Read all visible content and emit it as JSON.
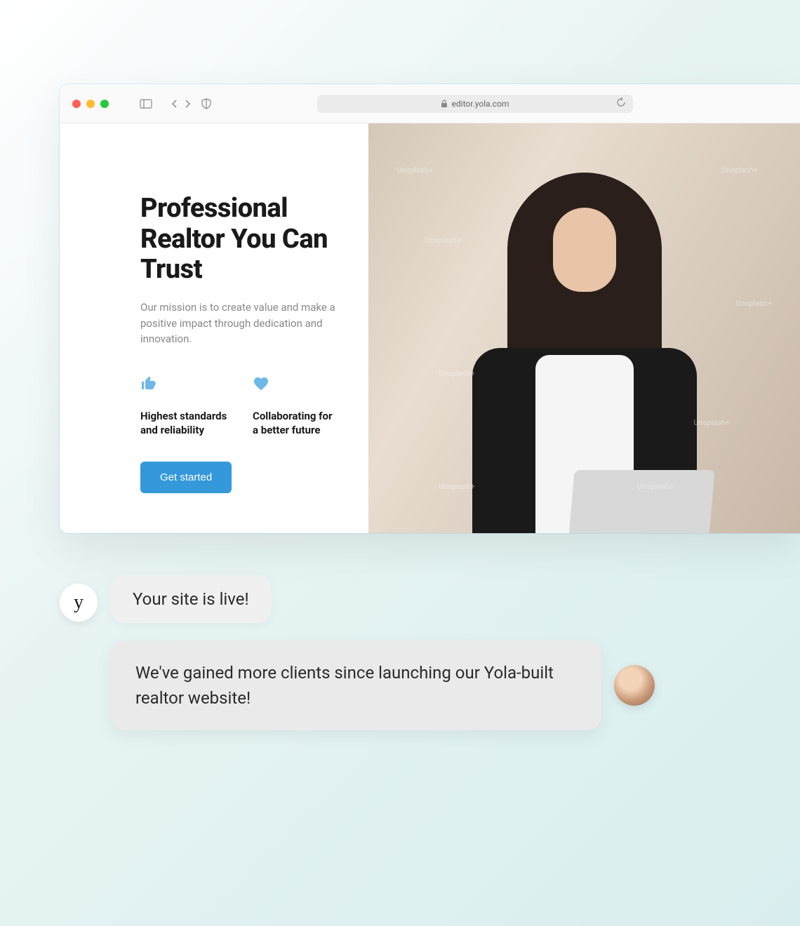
{
  "browser": {
    "url": "editor.yola.com"
  },
  "hero": {
    "title": "Professional Realtor You Can Trust",
    "subtitle": "Our mission is to create value and make a positive impact through dedication and innovation.",
    "feature1": "Highest standards and reliability",
    "feature2": "Collaborating for a better future",
    "cta": "Get started"
  },
  "chat": {
    "yola_letter": "y",
    "bubble1": "Your site is live!",
    "bubble2": "We've gained more clients since launching our Yola-built realtor website!"
  },
  "watermark": {
    "text": "Unsplash+"
  }
}
